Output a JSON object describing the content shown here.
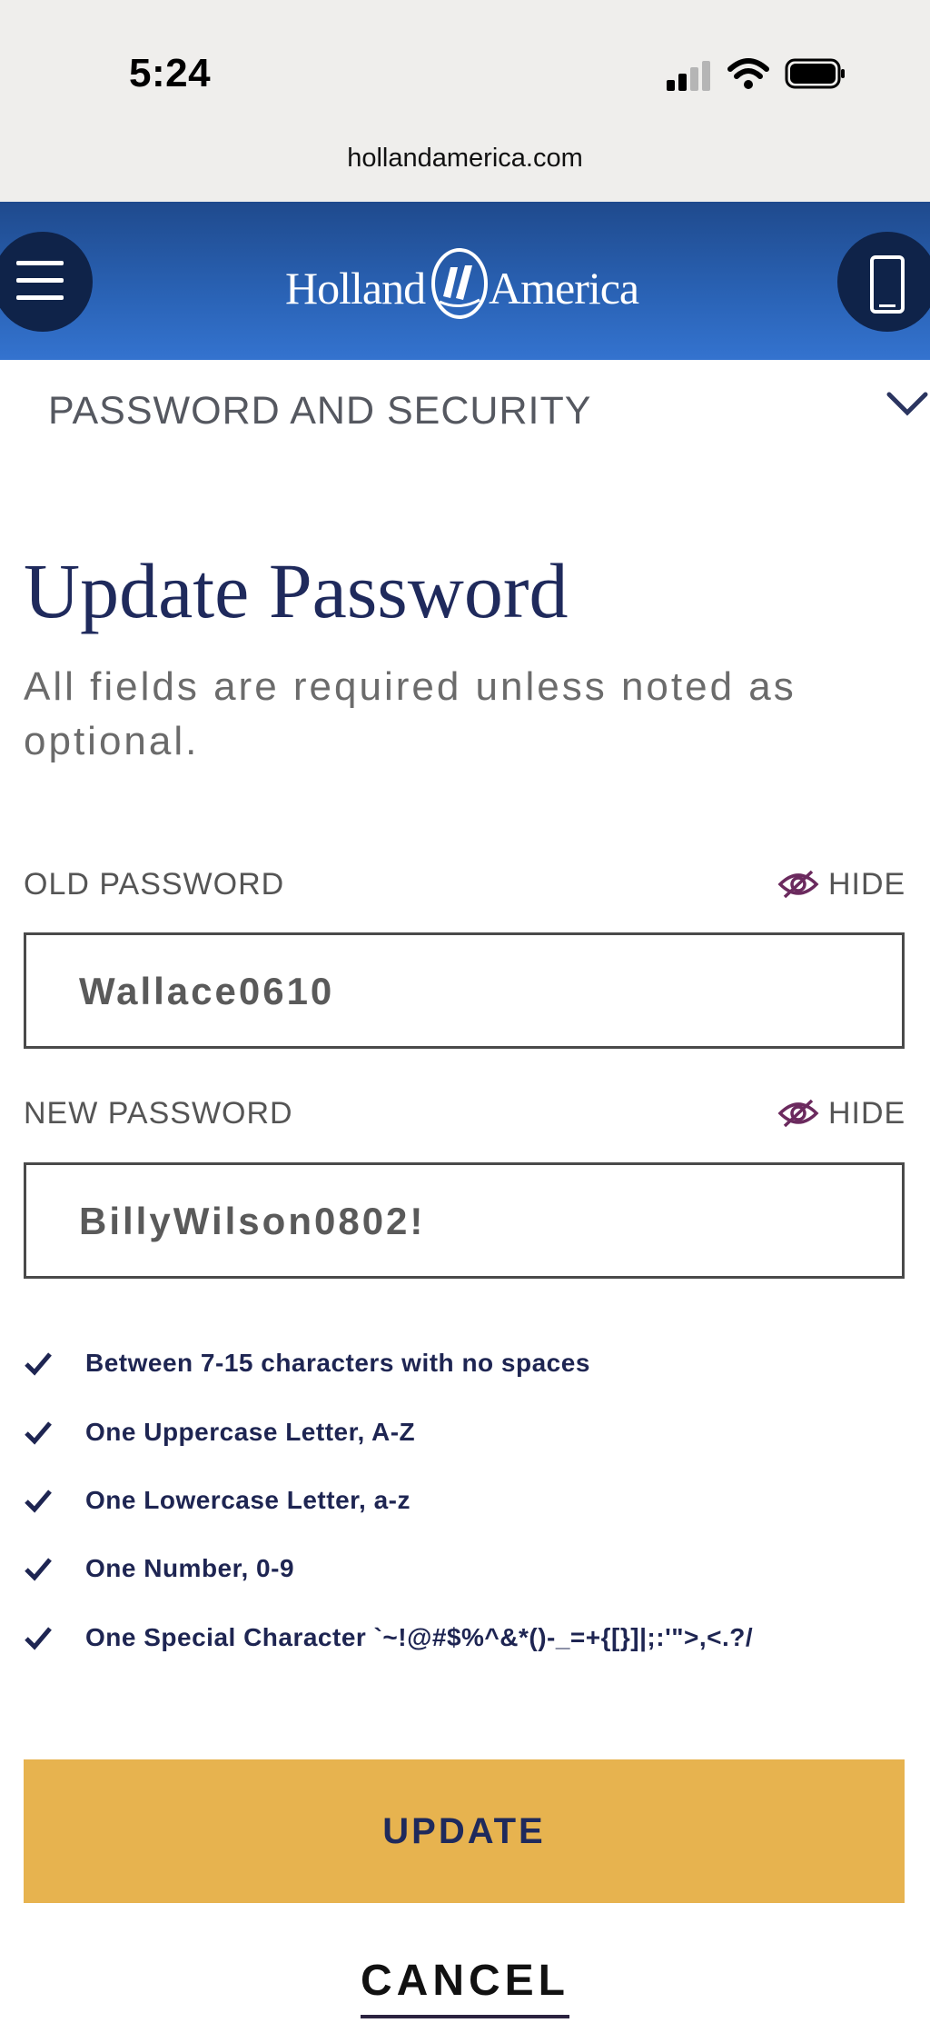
{
  "status_bar": {
    "time": "5:24"
  },
  "browser": {
    "url": "hollandamerica.com"
  },
  "header": {
    "logo_left": "Holland",
    "logo_right": "America"
  },
  "section": {
    "title": "PASSWORD AND SECURITY"
  },
  "form": {
    "title": "Update Password",
    "subtitle": "All fields are required unless noted as optional.",
    "old_password": {
      "label": "OLD PASSWORD",
      "toggle": "HIDE",
      "value": "Wallace0610"
    },
    "new_password": {
      "label": "NEW PASSWORD",
      "toggle": "HIDE",
      "value": "BillyWilson0802!"
    },
    "rules": [
      "Between 7-15 characters with no spaces",
      "One Uppercase Letter, A-Z",
      "One Lowercase Letter, a-z",
      "One Number, 0-9",
      "One Special Character `~!@#$%^&*()-_=+{[}]|;:'\">,<.?/"
    ],
    "update_label": "UPDATE",
    "cancel_label": "CANCEL"
  },
  "colors": {
    "header_blue": "#2a63b6",
    "navy": "#1f2a5c",
    "update_gold": "#e7b34f",
    "eye_icon_purple": "#6b2a5e"
  }
}
